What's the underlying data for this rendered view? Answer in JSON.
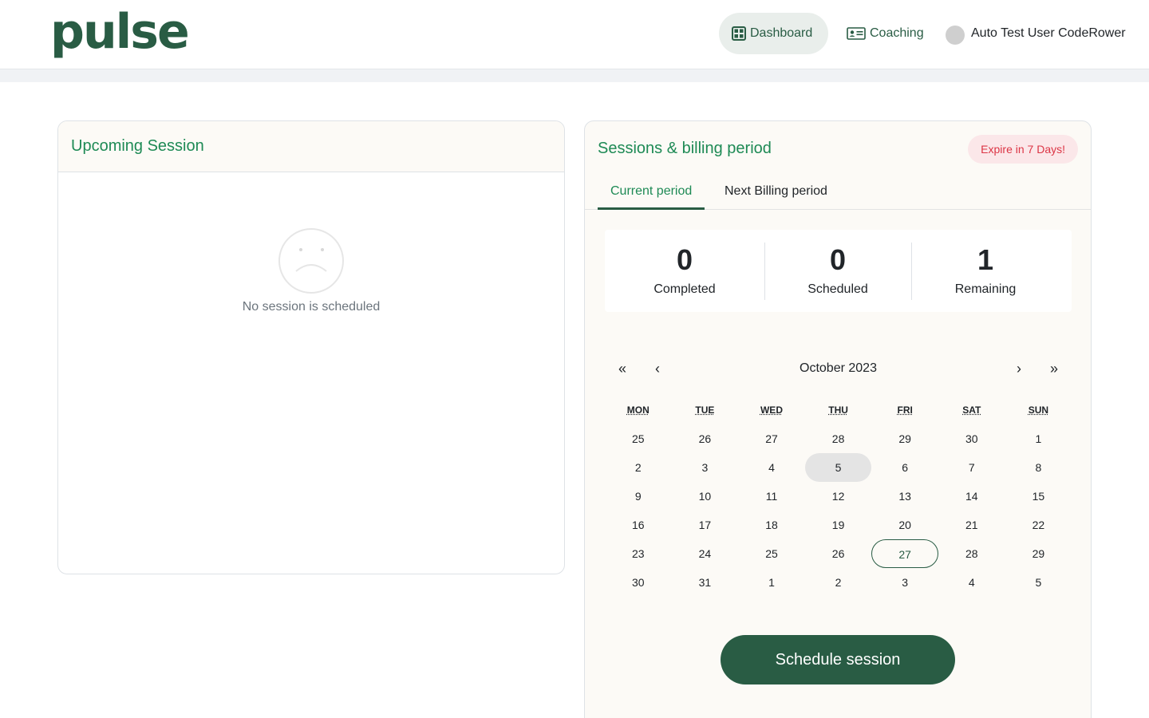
{
  "brand": {
    "name": "pulse",
    "color": "#295c44"
  },
  "nav": {
    "dashboard": {
      "label": "Dashboard",
      "icon": "grid-icon"
    },
    "coaching": {
      "label": "Coaching",
      "icon": "id-card-icon"
    }
  },
  "user": {
    "name": "Auto Test User CodeRower"
  },
  "upcoming": {
    "title": "Upcoming Session",
    "empty_icon": "sad-face-icon",
    "empty_text": "No session is scheduled"
  },
  "billing": {
    "title": "Sessions & billing period",
    "expire_badge": "Expire in 7 Days!",
    "tabs": [
      {
        "label": "Current period",
        "active": true
      },
      {
        "label": "Next Billing period",
        "active": false
      }
    ],
    "stats": [
      {
        "value": "0",
        "label": "Completed"
      },
      {
        "value": "0",
        "label": "Scheduled"
      },
      {
        "value": "1",
        "label": "Remaining"
      }
    ]
  },
  "calendar": {
    "month_label": "October 2023",
    "nav": {
      "prev_year": "«",
      "prev_month": "‹",
      "next_month": "›",
      "next_year": "»"
    },
    "weekdays": [
      "MON",
      "TUE",
      "WED",
      "THU",
      "FRI",
      "SAT",
      "SUN"
    ],
    "days": [
      "25",
      "26",
      "27",
      "28",
      "29",
      "30",
      "1",
      "2",
      "3",
      "4",
      "5",
      "6",
      "7",
      "8",
      "9",
      "10",
      "11",
      "12",
      "13",
      "14",
      "15",
      "16",
      "17",
      "18",
      "19",
      "20",
      "21",
      "22",
      "23",
      "24",
      "25",
      "26",
      "27",
      "28",
      "29",
      "30",
      "31",
      "1",
      "2",
      "3",
      "4",
      "5"
    ],
    "today_index": 10,
    "selected_index": 32
  },
  "actions": {
    "schedule_label": "Schedule session"
  },
  "colors": {
    "accent": "#1e8a55",
    "danger": "#dc3545",
    "panel_bg": "#fcfaf6"
  }
}
